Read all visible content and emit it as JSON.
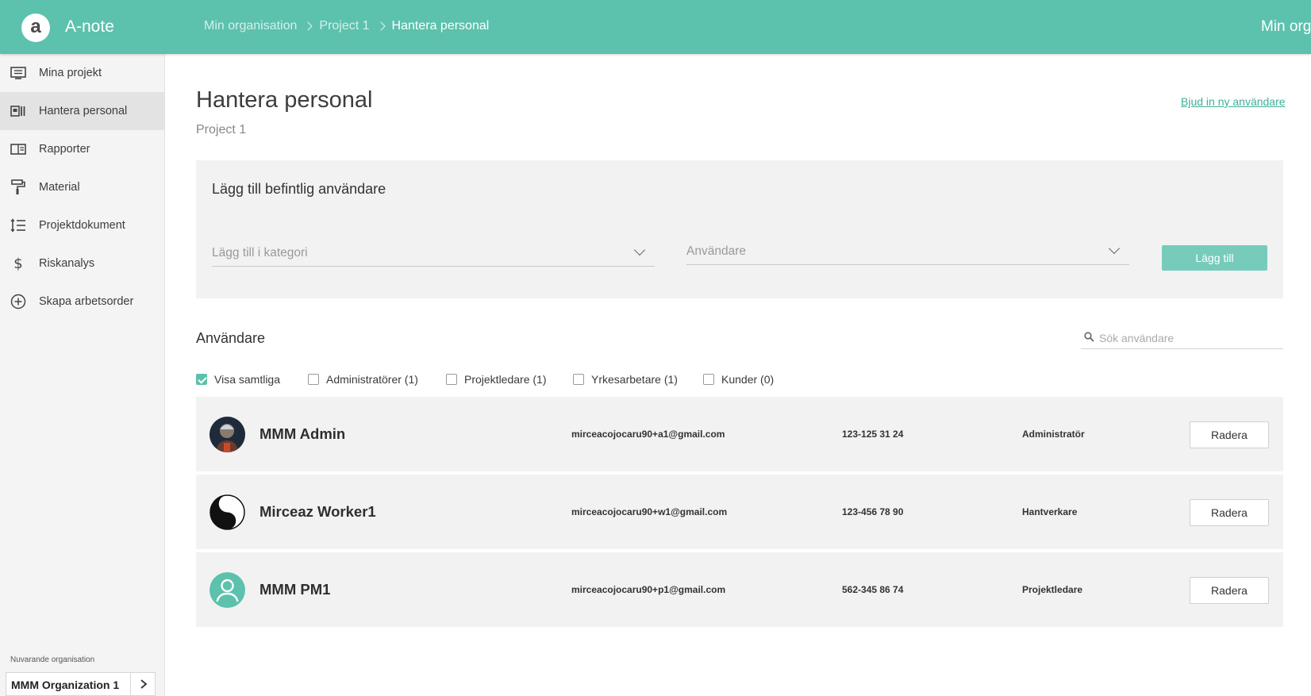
{
  "app": {
    "logo_letter": "a",
    "name": "A-note"
  },
  "breadcrumb": {
    "items": [
      "Min organisation",
      "Project 1"
    ],
    "current": "Hantera personal"
  },
  "header": {
    "org_label": "Min orga"
  },
  "sidebar": {
    "items": [
      {
        "label": "Mina projekt",
        "icon": "monitor-list-icon"
      },
      {
        "label": "Hantera personal",
        "icon": "id-card-icon",
        "active": true
      },
      {
        "label": "Rapporter",
        "icon": "report-icon"
      },
      {
        "label": "Material",
        "icon": "paint-roller-icon"
      },
      {
        "label": "Projektdokument",
        "icon": "numbered-list-icon"
      },
      {
        "label": "Riskanalys",
        "icon": "dollar-icon"
      },
      {
        "label": "Skapa arbetsorder",
        "icon": "plus-circle-icon"
      }
    ],
    "org_caption": "Nuvarande organisation",
    "org_name": "MMM Organization 1"
  },
  "page": {
    "title": "Hantera personal",
    "subtitle": "Project 1",
    "invite_link": "Bjud in ny användare"
  },
  "add_panel": {
    "title": "Lägg till befintlig användare",
    "category_placeholder": "Lägg till i kategori",
    "user_placeholder": "Användare",
    "add_button": "Lägg till"
  },
  "users": {
    "heading": "Användare",
    "search_placeholder": "Sök användare",
    "filters": [
      {
        "label": "Visa samtliga",
        "checked": true
      },
      {
        "label": "Administratörer (1)",
        "checked": false
      },
      {
        "label": "Projektledare (1)",
        "checked": false
      },
      {
        "label": "Yrkesarbetare (1)",
        "checked": false
      },
      {
        "label": "Kunder (0)",
        "checked": false
      }
    ],
    "delete_label": "Radera",
    "rows": [
      {
        "name": "MMM Admin",
        "email": "mirceacojocaru90+a1@gmail.com",
        "phone": "123-125 31 24",
        "role": "Administratör",
        "avatar": "photo"
      },
      {
        "name": "Mirceaz Worker1",
        "email": "mirceacojocaru90+w1@gmail.com",
        "phone": "123-456 78 90",
        "role": "Hantverkare",
        "avatar": "yin-yang"
      },
      {
        "name": "MMM PM1",
        "email": "mirceacojocaru90+p1@gmail.com",
        "phone": "562-345 86 74",
        "role": "Projektledare",
        "avatar": "default-user"
      }
    ]
  },
  "colors": {
    "primary": "#5cc1ad",
    "button": "#77cbba",
    "link": "#3fae98",
    "panel": "#f2f2f2"
  }
}
